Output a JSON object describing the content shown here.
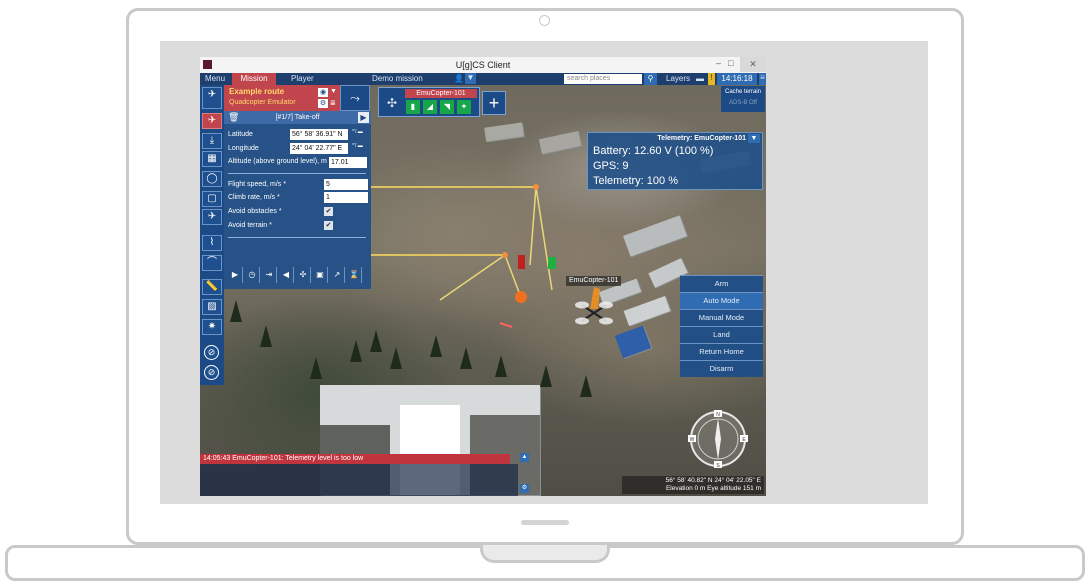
{
  "window": {
    "title": "U[g]CS Client",
    "minimize": "–",
    "maximize": "□",
    "close": "✕"
  },
  "menubar": {
    "menu": "Menu",
    "mission": "Mission",
    "player": "Player",
    "mission_name": "Demo mission",
    "search_placeholder": "search places",
    "layers": "Layers",
    "clock": "14:16:18"
  },
  "route": {
    "name": "Example route",
    "vehicle_type": "Quadcopter Emulator"
  },
  "waypoint": {
    "header": "[#1/7] Take-off",
    "latitude_label": "Latitude",
    "latitude": "56° 58' 36.91\" N",
    "longitude_label": "Longitude",
    "longitude": "24° 04' 22.77\" E",
    "altitude_label": "Altitude (above ground level), m",
    "altitude": "17.01",
    "speed_label": "Flight speed, m/s *",
    "speed": "5",
    "climb_label": "Climb rate, m/s *",
    "climb": "1",
    "avoid_obstacles_label": "Avoid obstacles *",
    "avoid_obstacles": true,
    "avoid_terrain_label": "Avoid terrain *",
    "avoid_terrain": true
  },
  "vehicle": {
    "name": "EmuCopter-101",
    "map_label": "EmuCopter-101"
  },
  "cache": {
    "title": "Cache terrain",
    "adsb": "ADS-B Off"
  },
  "telemetry": {
    "title": "Telemetry: EmuCopter-101",
    "battery": "Battery: 12.60 V (100 %)",
    "gps": "GPS: 9",
    "telemetry": "Telemetry: 100 %"
  },
  "controls": [
    "Arm",
    "Auto Mode",
    "Manual Mode",
    "Land",
    "Return Home",
    "Disarm"
  ],
  "log": {
    "message": "14:05:43  EmuCopter-101: Telemetry level is too low"
  },
  "status": {
    "coords": "56° 58' 40.82\" N  24° 04' 22.05\" E",
    "elevation": "Elevation 0 m   Eye altitude 151 m"
  },
  "compass": {
    "n": "N",
    "e": "E",
    "s": "S",
    "w": "W"
  },
  "colors": {
    "accent": "#c0454d",
    "panel": "#1c4a86",
    "button": "#2f6cb2",
    "ok": "#18a64a"
  }
}
